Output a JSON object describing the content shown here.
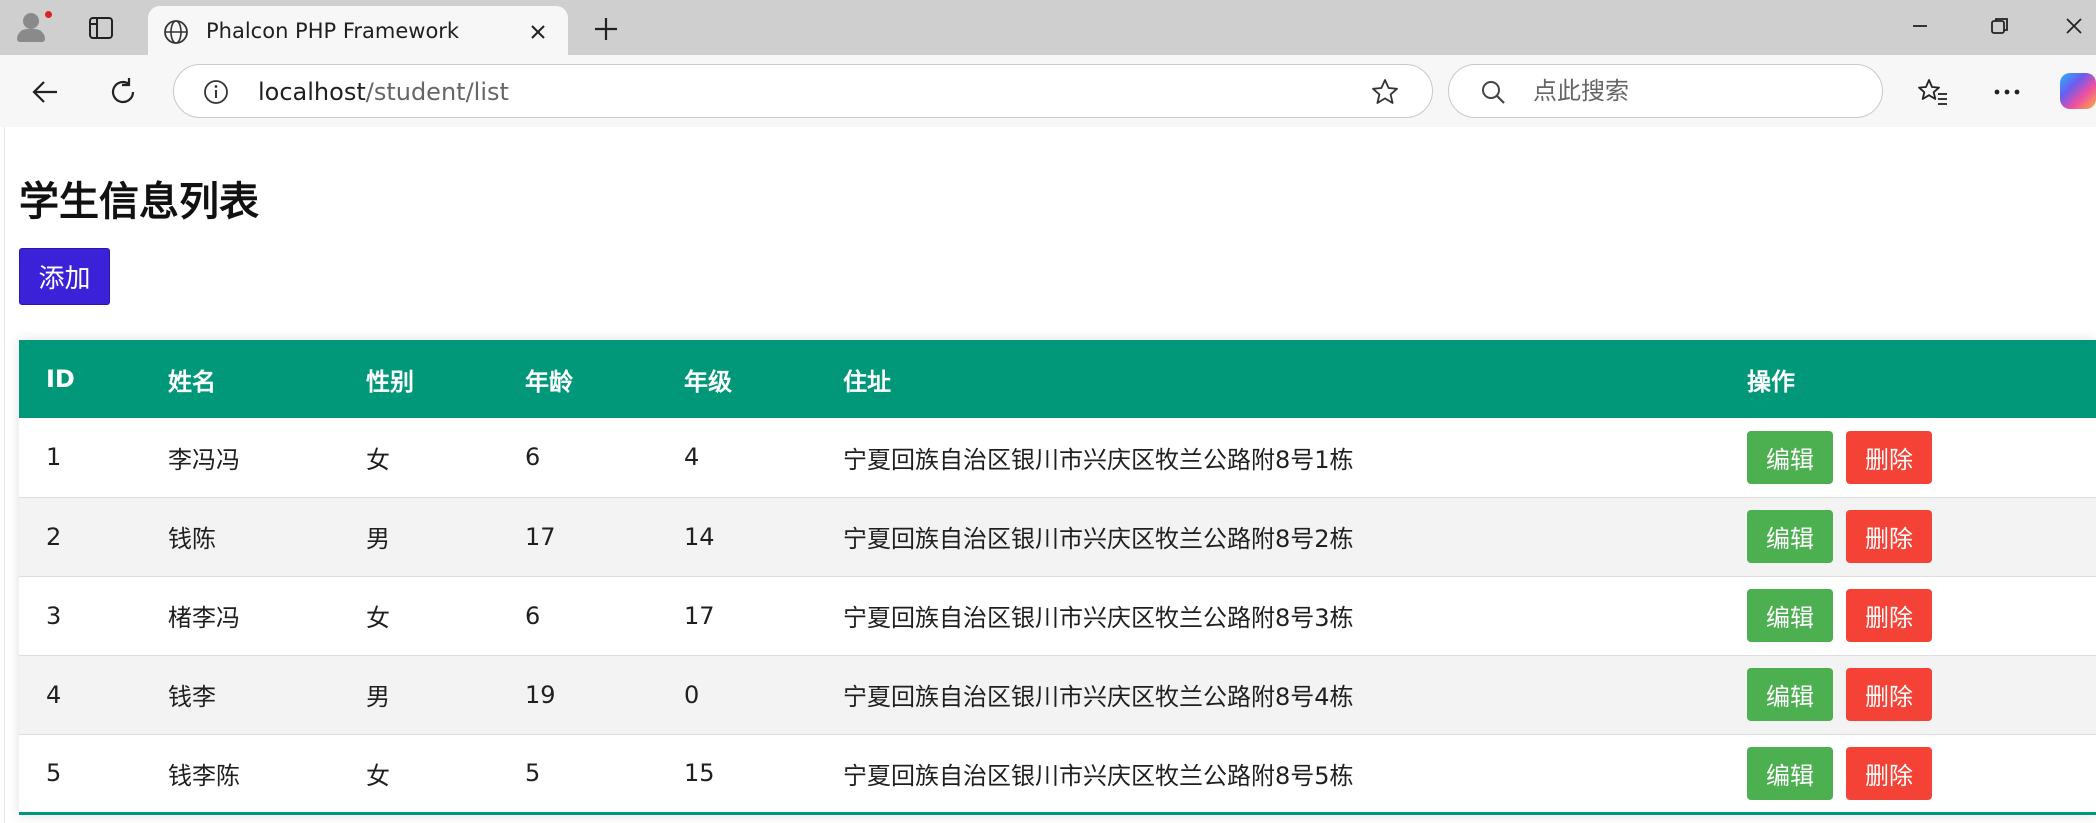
{
  "browser": {
    "tab_title": "Phalcon PHP Framework",
    "url_host": "localhost",
    "url_path": "/student/list",
    "search_placeholder": "点此搜索"
  },
  "page": {
    "title": "学生信息列表",
    "add_label": "添加"
  },
  "table": {
    "headers": [
      "ID",
      "姓名",
      "性别",
      "年龄",
      "年级",
      "住址",
      "操作"
    ],
    "edit_label": "编辑",
    "delete_label": "删除",
    "rows": [
      {
        "id": "1",
        "name": "李冯冯",
        "gender": "女",
        "age": "6",
        "grade": "4",
        "address": "宁夏回族自治区银川市兴庆区牧兰公路附8号1栋"
      },
      {
        "id": "2",
        "name": "钱陈",
        "gender": "男",
        "age": "17",
        "grade": "14",
        "address": "宁夏回族自治区银川市兴庆区牧兰公路附8号2栋"
      },
      {
        "id": "3",
        "name": "楮李冯",
        "gender": "女",
        "age": "6",
        "grade": "17",
        "address": "宁夏回族自治区银川市兴庆区牧兰公路附8号3栋"
      },
      {
        "id": "4",
        "name": "钱李",
        "gender": "男",
        "age": "19",
        "grade": "0",
        "address": "宁夏回族自治区银川市兴庆区牧兰公路附8号4栋"
      },
      {
        "id": "5",
        "name": "钱李陈",
        "gender": "女",
        "age": "5",
        "grade": "15",
        "address": "宁夏回族自治区银川市兴庆区牧兰公路附8号5栋"
      }
    ]
  },
  "colors": {
    "table_header": "#009879",
    "add_button": "#3b22d8",
    "edit_button": "#4caf50",
    "delete_button": "#f44336"
  },
  "icons": [
    "profile-icon",
    "tab-actions-icon",
    "globe-icon",
    "close-icon",
    "plus-icon",
    "minimize-icon",
    "restore-icon",
    "window-close-icon",
    "back-icon",
    "refresh-icon",
    "info-icon",
    "star-icon",
    "search-icon",
    "favorites-icon",
    "more-icon",
    "copilot-icon"
  ]
}
